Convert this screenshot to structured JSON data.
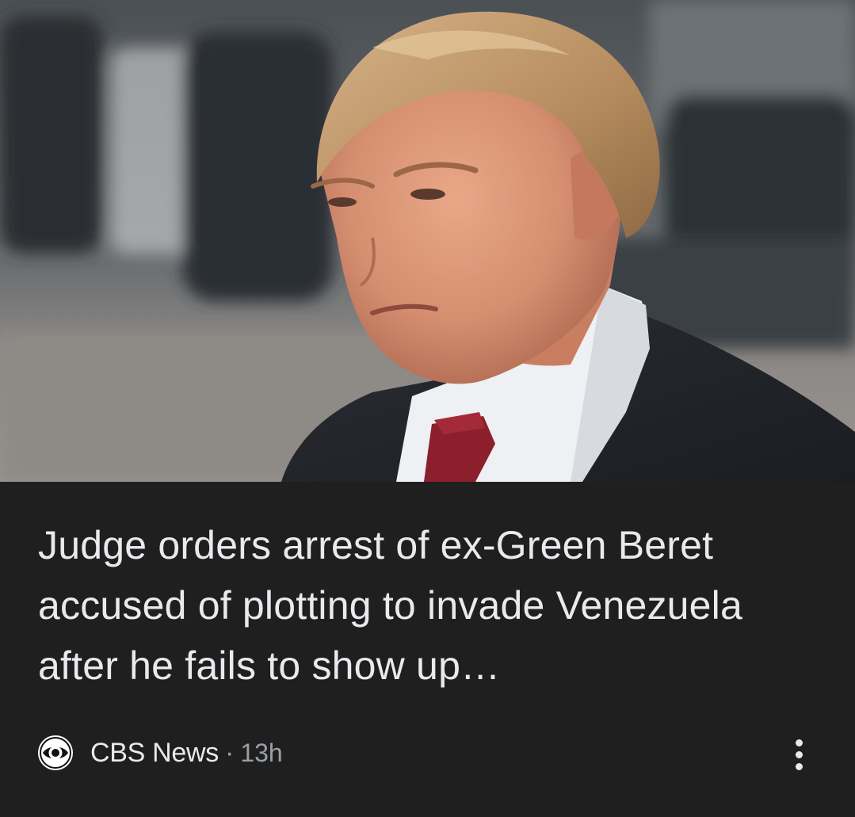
{
  "article": {
    "headline": "Judge orders arrest of ex-Green Beret accused of plotting to invade Venezuela after he fails to show up…",
    "source": "CBS News",
    "separator": "·",
    "age": "13h"
  },
  "icons": {
    "source_logo": "cbs-eye-logo",
    "more": "more-vert-icon"
  },
  "colors": {
    "card_background": "#1f1f1f",
    "headline_text": "#e8eaed",
    "meta_text": "#9aa0a6"
  }
}
